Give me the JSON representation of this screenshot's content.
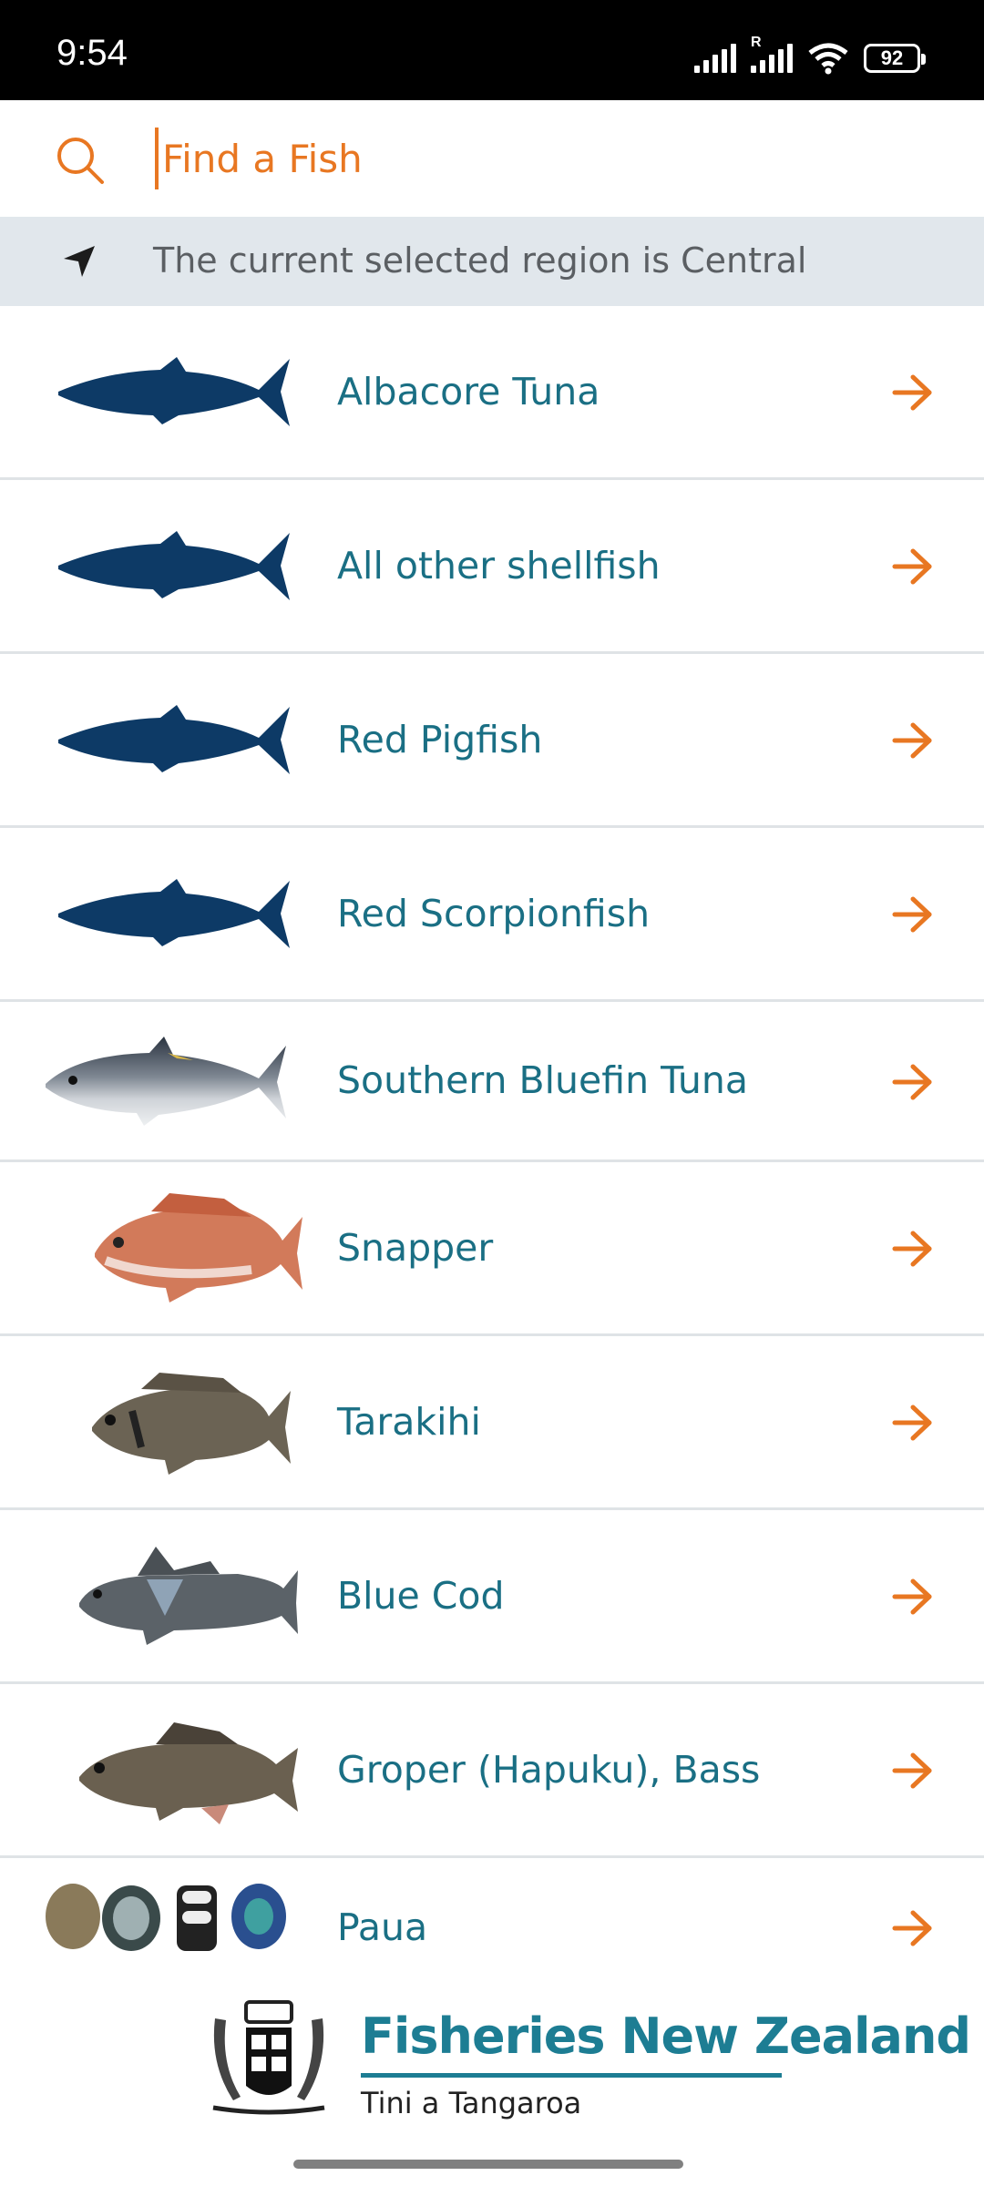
{
  "status_bar": {
    "time": "9:54",
    "battery": "92",
    "signal_label": "R"
  },
  "search": {
    "placeholder": "Find a Fish"
  },
  "region": {
    "text": "The current selected region is Central"
  },
  "fish_list": [
    {
      "name": "Albacore Tuna",
      "thumbnail": "fish-silhouette"
    },
    {
      "name": "All other shellfish",
      "thumbnail": "fish-silhouette"
    },
    {
      "name": "Red Pigfish",
      "thumbnail": "fish-silhouette"
    },
    {
      "name": "Red Scorpionfish",
      "thumbnail": "fish-silhouette"
    },
    {
      "name": "Southern Bluefin Tuna",
      "thumbnail": "tuna-photo"
    },
    {
      "name": "Snapper",
      "thumbnail": "snapper-photo"
    },
    {
      "name": "Tarakihi",
      "thumbnail": "tarakihi-photo"
    },
    {
      "name": "Blue Cod",
      "thumbnail": "blue-cod-photo"
    },
    {
      "name": "Groper (Hapuku), Bass",
      "thumbnail": "groper-photo"
    },
    {
      "name": "Paua",
      "thumbnail": "paua-shells-photo"
    }
  ],
  "footer": {
    "brand_title": "Fisheries New Zealand",
    "brand_subtitle": "Tini a Tangaroa"
  },
  "colors": {
    "accent": "#e87722",
    "text_teal": "#1a6f84",
    "silhouette": "#0d3a66",
    "region_bg": "#e1e7ec",
    "brand": "#1d7d93"
  }
}
